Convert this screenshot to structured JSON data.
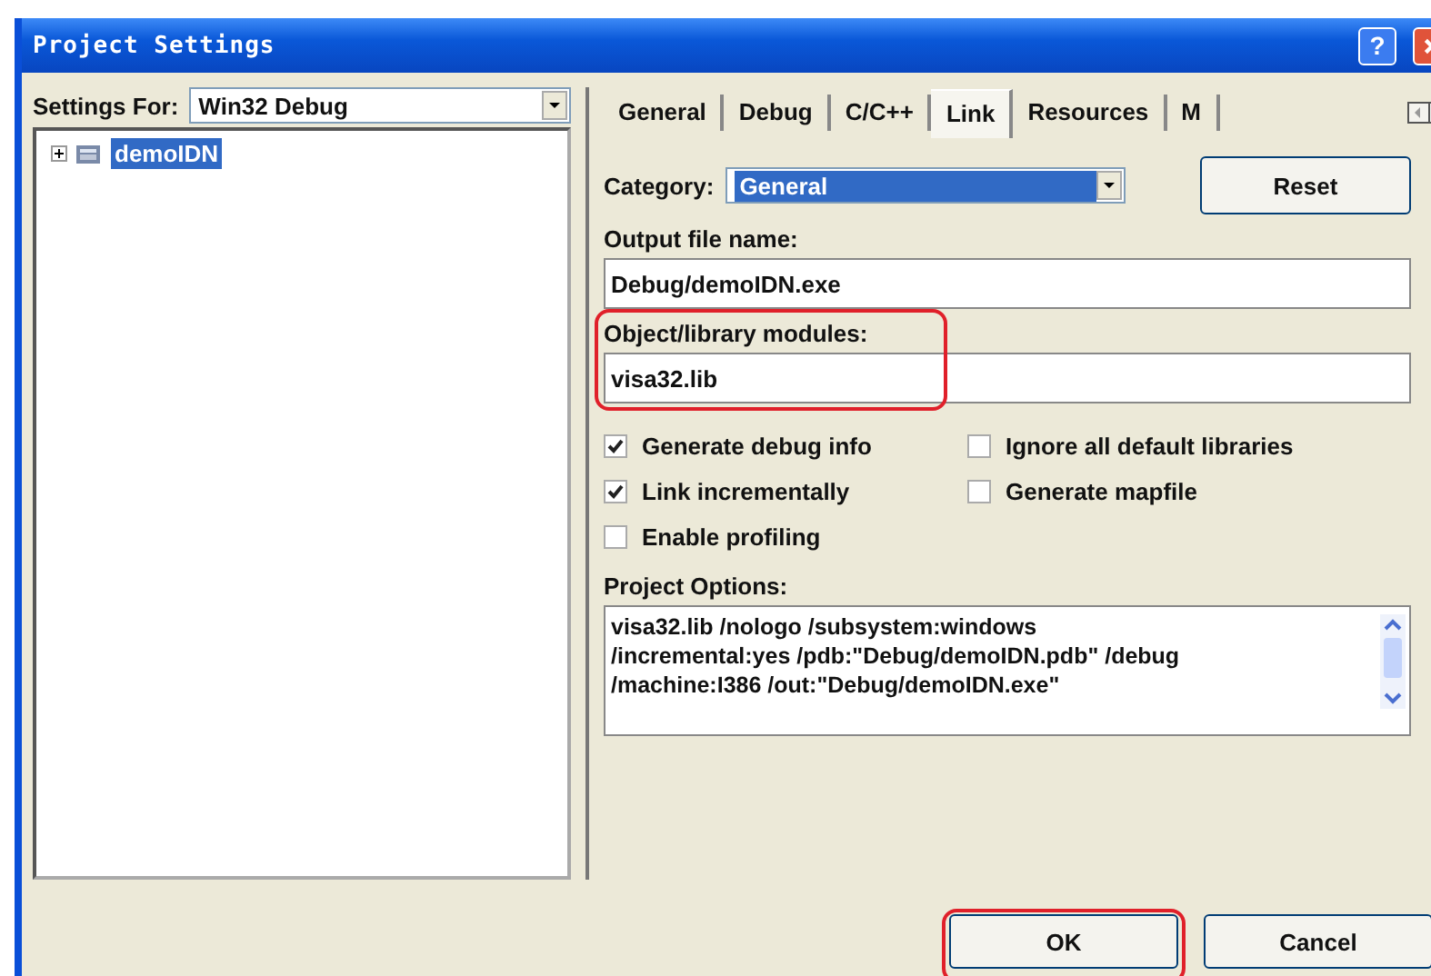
{
  "window": {
    "title": "Project Settings",
    "help_button": "?"
  },
  "settings_for": {
    "label": "Settings For:",
    "value": "Win32 Debug"
  },
  "tree": {
    "items": [
      {
        "label": "demoIDN",
        "selected": true,
        "expanded": false
      }
    ]
  },
  "tabs": [
    {
      "label": "General",
      "selected": false
    },
    {
      "label": "Debug",
      "selected": false
    },
    {
      "label": "C/C++",
      "selected": false
    },
    {
      "label": "Link",
      "selected": true
    },
    {
      "label": "Resources",
      "selected": false
    },
    {
      "label": "M",
      "selected": false
    }
  ],
  "category": {
    "label": "Category:",
    "value": "General"
  },
  "reset_button": "Reset",
  "output_file": {
    "label": "Output file name:",
    "value": "Debug/demoIDN.exe"
  },
  "modules": {
    "label": "Object/library modules:",
    "value": "visa32.lib",
    "highlighted": true
  },
  "options": [
    {
      "label": "Generate debug info",
      "checked": true
    },
    {
      "label": "Ignore all default libraries",
      "checked": false
    },
    {
      "label": "Link incrementally",
      "checked": true
    },
    {
      "label": "Generate mapfile",
      "checked": false
    },
    {
      "label": "Enable profiling",
      "checked": false
    }
  ],
  "project_options": {
    "label": "Project Options:",
    "lines": [
      "visa32.lib /nologo /subsystem:windows",
      "/incremental:yes /pdb:\"Debug/demoIDN.pdb\" /debug",
      "/machine:I386 /out:\"Debug/demoIDN.exe\""
    ]
  },
  "buttons": [
    {
      "label": "OK",
      "highlighted": true
    },
    {
      "label": "Cancel",
      "highlighted": false
    }
  ]
}
